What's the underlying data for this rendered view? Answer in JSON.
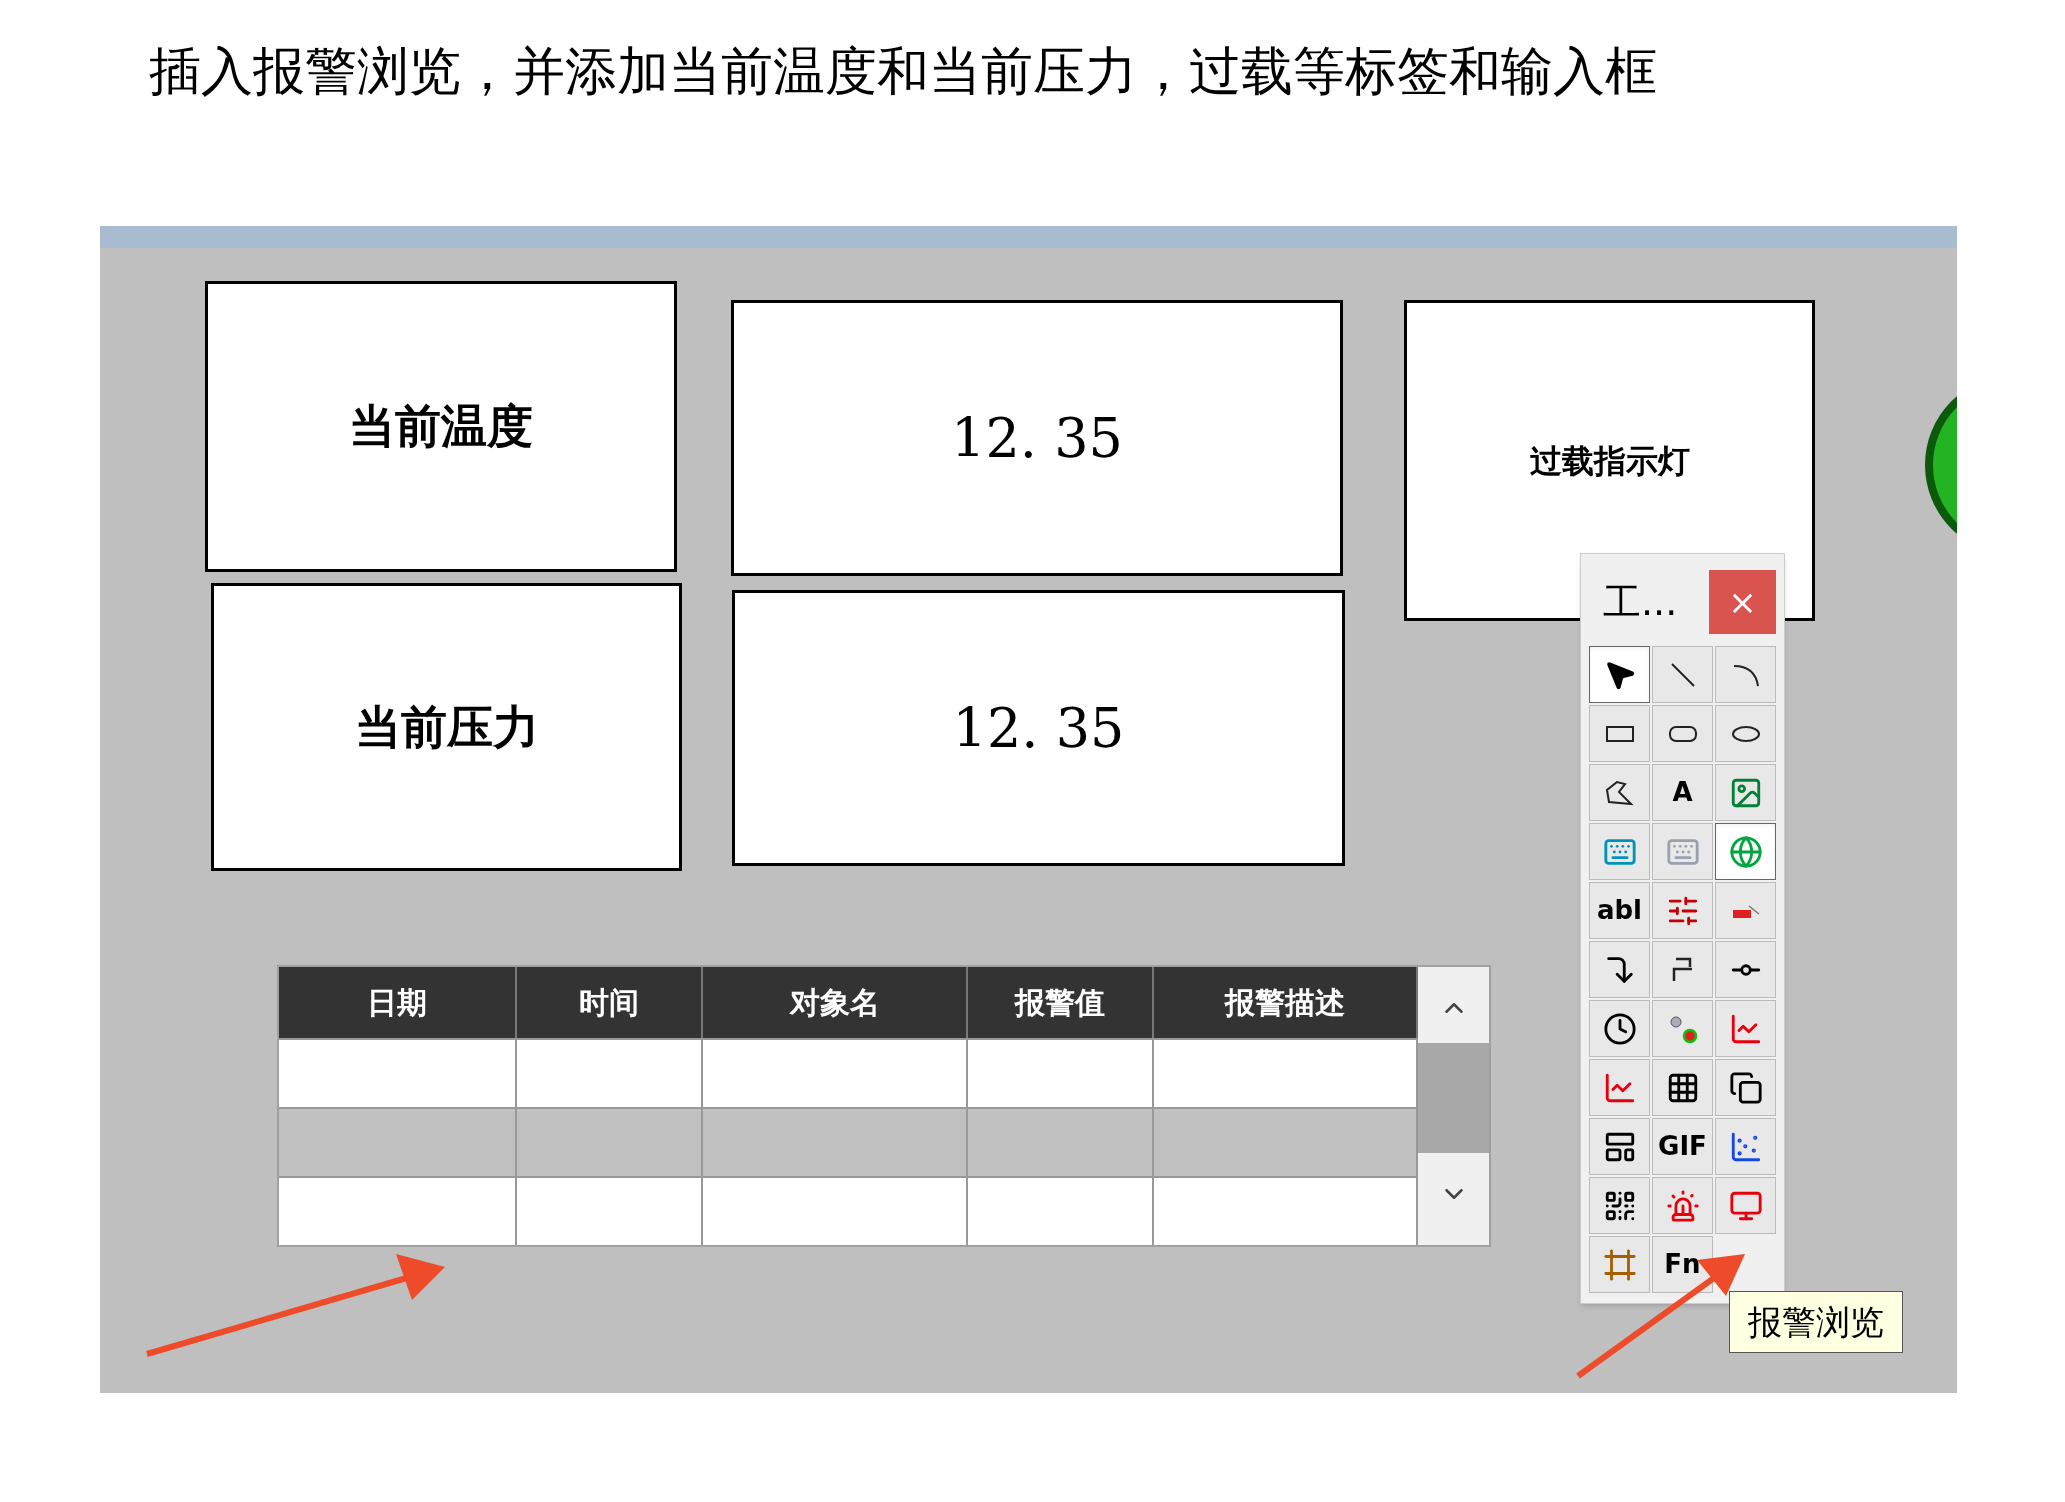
{
  "instruction": "插入报警浏览，并添加当前温度和当前压力，过载等标签和输入框",
  "canvas": {
    "labels": [
      {
        "kind": "label",
        "text": "当前温度"
      },
      {
        "kind": "value",
        "text": "12. 35"
      },
      {
        "kind": "indicator",
        "text": "过载指示灯"
      },
      {
        "kind": "label",
        "text": "当前压力"
      },
      {
        "kind": "value",
        "text": "12. 35"
      }
    ],
    "alarm_table": {
      "columns": [
        "日期",
        "时间",
        "对象名",
        "报警值",
        "报警描述"
      ],
      "rows": [
        {
          "shaded": false
        },
        {
          "shaded": true
        },
        {
          "shaded": false
        }
      ]
    }
  },
  "toolbox": {
    "title": "工...",
    "close": "×",
    "tools": [
      {
        "kind": "pointer",
        "selected": true
      },
      {
        "kind": "line",
        "selected": false
      },
      {
        "kind": "arc",
        "selected": false
      },
      {
        "kind": "rect",
        "selected": false
      },
      {
        "kind": "roundrect",
        "selected": false
      },
      {
        "kind": "ellipse",
        "selected": false
      },
      {
        "kind": "polygon",
        "selected": false
      },
      {
        "kind": "glyph",
        "label": "A",
        "selected": false
      },
      {
        "kind": "image",
        "selected": false
      },
      {
        "kind": "keyboard",
        "selected": false
      },
      {
        "kind": "keyboard-disabled",
        "selected": false
      },
      {
        "kind": "globe",
        "selected": true
      },
      {
        "kind": "glyph",
        "label": "abl",
        "selected": false
      },
      {
        "kind": "slider",
        "selected": false
      },
      {
        "kind": "bar",
        "selected": false
      },
      {
        "kind": "corner",
        "selected": false
      },
      {
        "kind": "step",
        "selected": false
      },
      {
        "kind": "valve",
        "selected": false
      },
      {
        "kind": "clock",
        "selected": false
      },
      {
        "kind": "dots",
        "selected": false
      },
      {
        "kind": "chart",
        "selected": false
      },
      {
        "kind": "chart",
        "selected": false
      },
      {
        "kind": "grid",
        "selected": false
      },
      {
        "kind": "stack",
        "selected": false
      },
      {
        "kind": "layout",
        "selected": false
      },
      {
        "kind": "glyph",
        "label": "GIF",
        "selected": false
      },
      {
        "kind": "plot",
        "selected": false
      },
      {
        "kind": "qr",
        "selected": false
      },
      {
        "kind": "siren",
        "selected": false
      },
      {
        "kind": "monitor",
        "selected": false
      },
      {
        "kind": "picture",
        "selected": false
      },
      {
        "kind": "glyph",
        "label": "Fn",
        "selected": false
      }
    ],
    "tooltip": "报警浏览"
  }
}
